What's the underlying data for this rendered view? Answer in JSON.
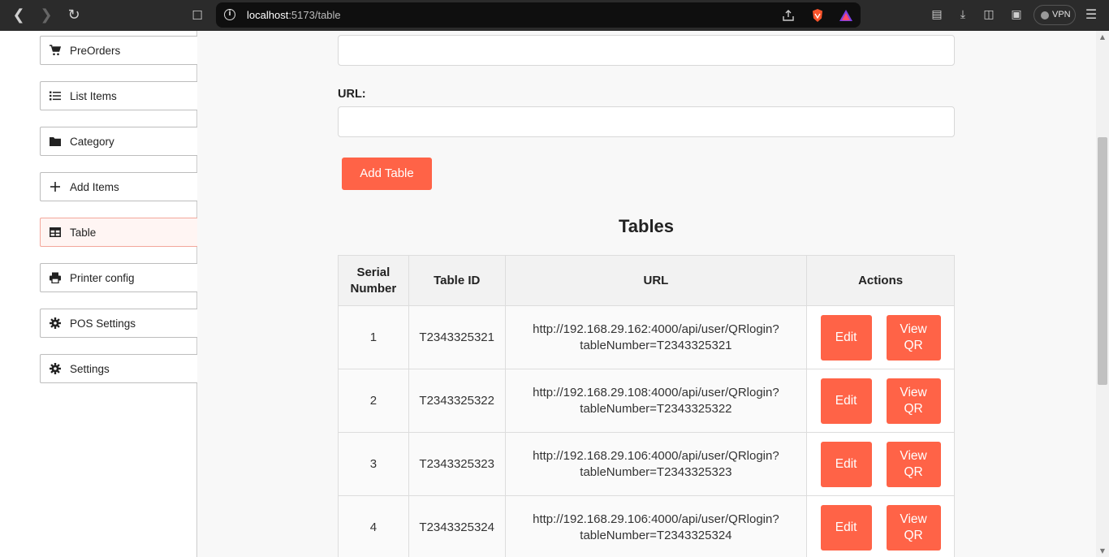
{
  "browser": {
    "url_host": "localhost",
    "url_path": ":5173/table",
    "vpn_label": "VPN"
  },
  "sidebar": {
    "items": [
      {
        "label": "PreOrders",
        "icon": "cart-icon"
      },
      {
        "label": "List Items",
        "icon": "list-icon"
      },
      {
        "label": "Category",
        "icon": "folder-icon"
      },
      {
        "label": "Add Items",
        "icon": "plus-icon"
      },
      {
        "label": "Table",
        "icon": "table-icon",
        "active": true
      },
      {
        "label": "Printer config",
        "icon": "printer-icon"
      },
      {
        "label": "POS Settings",
        "icon": "gear-icon"
      },
      {
        "label": "Settings",
        "icon": "gear-icon"
      }
    ]
  },
  "form": {
    "url_label": "URL:",
    "add_button": "Add Table"
  },
  "tables_section": {
    "title": "Tables",
    "headers": [
      "Serial\nNumber",
      "Table ID",
      "URL",
      "Actions"
    ],
    "rows": [
      {
        "serial": "1",
        "table_id": "T2343325321",
        "url_line1": "http://192.168.29.162:4000/api/user/QRlogin?",
        "url_line2": "tableNumber=T2343325321",
        "edit": "Edit",
        "view": "View QR"
      },
      {
        "serial": "2",
        "table_id": "T2343325322",
        "url_line1": "http://192.168.29.108:4000/api/user/QRlogin?",
        "url_line2": "tableNumber=T2343325322",
        "edit": "Edit",
        "view": "View QR"
      },
      {
        "serial": "3",
        "table_id": "T2343325323",
        "url_line1": "http://192.168.29.106:4000/api/user/QRlogin?",
        "url_line2": "tableNumber=T2343325323",
        "edit": "Edit",
        "view": "View QR"
      },
      {
        "serial": "4",
        "table_id": "T2343325324",
        "url_line1": "http://192.168.29.106:4000/api/user/QRlogin?",
        "url_line2": "tableNumber=T2343325324",
        "edit": "Edit",
        "view": "View QR"
      }
    ]
  },
  "colors": {
    "accent": "#ff6347",
    "active_bg": "#fff5f3"
  }
}
